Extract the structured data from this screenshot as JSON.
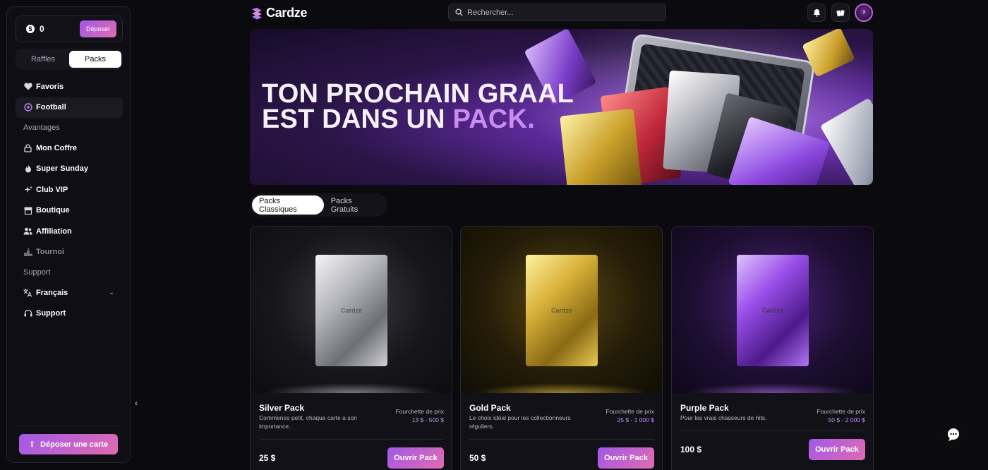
{
  "brand": {
    "name": "Cardze",
    "accent": "#a259e8"
  },
  "wallet": {
    "currency_symbol": "$",
    "balance": "0",
    "deposit_label": "Déposer"
  },
  "segment": {
    "items": [
      "Raffles",
      "Packs"
    ],
    "active": "Packs"
  },
  "nav": {
    "favorites": "Favoris",
    "football": "Football",
    "section_benefits": "Avantages",
    "vault": "Mon Coffre",
    "super_sunday": "Super Sunday",
    "club_vip": "Club VIP",
    "shop": "Boutique",
    "affiliation": "Affiliation",
    "tournament": "Tournoi",
    "section_support": "Support",
    "language": "Français",
    "support": "Support"
  },
  "upload_label": "Déposer une carte",
  "search": {
    "placeholder": "Rechercher..."
  },
  "banner": {
    "line1": "TON PROCHAIN GRAAL",
    "line2_start": "EST DANS UN ",
    "line2_accent": "PACK."
  },
  "tabs": {
    "classic": "Packs Classiques",
    "free": "Packs Gratuits",
    "active": "Packs Classiques"
  },
  "packs": [
    {
      "name": "Silver Pack",
      "description": "Commence petit, chaque carte a son importance.",
      "range_label": "Fourchette de prix",
      "range": "13 $ - 500 $",
      "price": "25 $",
      "button": "Ouvrir Pack",
      "pack_text": "Cardze",
      "color": "#c8c8cc"
    },
    {
      "name": "Gold Pack",
      "description": "Le choix idéal pour les collectionneurs réguliers.",
      "range_label": "Fourchette de prix",
      "range": "25 $ - 1 000 $",
      "price": "50 $",
      "button": "Ouvrir Pack",
      "pack_text": "Cardze",
      "color": "#d8b036"
    },
    {
      "name": "Purple Pack",
      "description": "Pour les vrais chasseurs de hits.",
      "range_label": "Fourchette de prix",
      "range": "50 $ - 2 000 $",
      "price": "100 $",
      "button": "Ouvrir Pack",
      "pack_text": "Cardze",
      "color": "#9f4fe6"
    }
  ],
  "icons": [
    "heart-icon",
    "football-icon",
    "lock-icon",
    "fire-icon",
    "sparkle-icon",
    "store-icon",
    "users-icon",
    "podium-icon",
    "translate-icon",
    "headset-icon",
    "upload-icon",
    "search-icon",
    "bell-icon",
    "cards-icon",
    "chat-icon",
    "chevron-left-icon",
    "chevron-down-icon"
  ]
}
